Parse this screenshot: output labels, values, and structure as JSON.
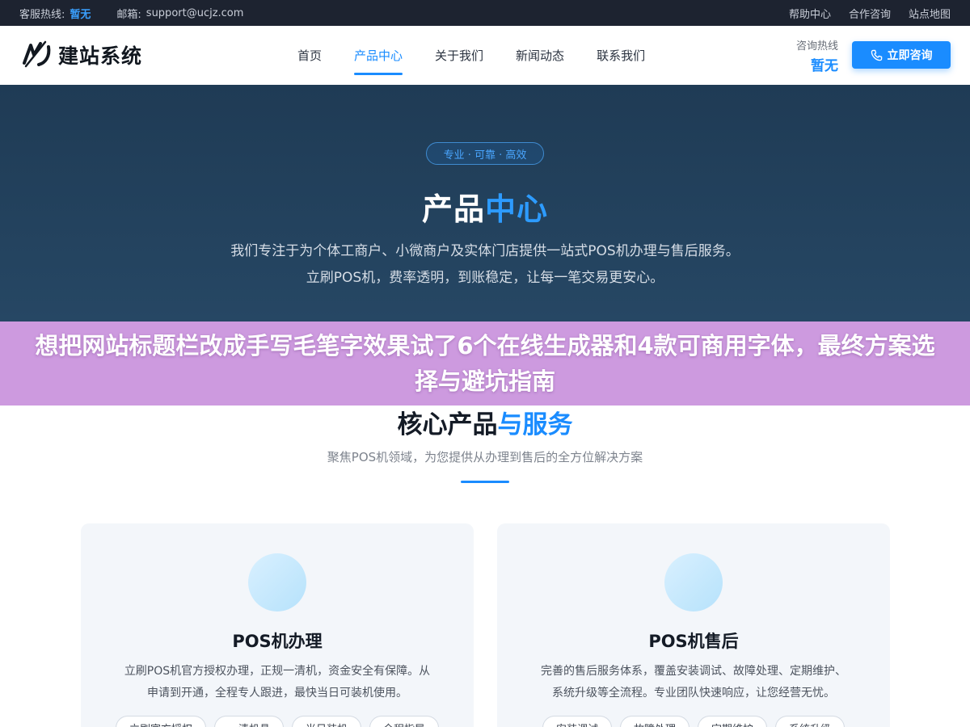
{
  "topbar": {
    "hotline_label": "客服热线:",
    "hotline_value": "暂无",
    "email_label": "邮箱:",
    "email_value": "support@ucjz.com",
    "links": [
      "帮助中心",
      "合作咨询",
      "站点地图"
    ]
  },
  "header": {
    "logo_text": "建站系统",
    "nav": [
      "首页",
      "产品中心",
      "关于我们",
      "新闻动态",
      "联系我们"
    ],
    "active_nav": "产品中心",
    "consult_label": "咨询热线",
    "consult_value": "暂无",
    "cta_label": "立即咨询"
  },
  "hero": {
    "pill": "专业 · 可靠 · 高效",
    "title_main": "产品",
    "title_accent": "中心",
    "desc_line1": "我们专注于为个体工商户、小微商户及实体门店提供一站式POS机办理与售后服务。",
    "desc_line2": "立刷POS机，费率透明，到账稳定，让每一笔交易更安心。"
  },
  "banner": {
    "text": "想把网站标题栏改成手写毛笔字效果试了6个在线生成器和4款可商用字体，最终方案选择与避坑指南"
  },
  "section": {
    "title_main": "核心产品",
    "title_accent": "与服务",
    "subtitle": "聚焦POS机领域，为您提供从办理到售后的全方位解决方案"
  },
  "cards": [
    {
      "title": "POS机办理",
      "desc_line1": "立刷POS机官方授权办理，正规一清机，资金安全有保障。从",
      "desc_line2": "申请到开通，全程专人跟进，最快当日可装机使用。",
      "tags": [
        "立刷官方授权",
        "一清机具",
        "当日装机",
        "全程指导"
      ]
    },
    {
      "title": "POS机售后",
      "desc_line1": "完善的售后服务体系，覆盖安装调试、故障处理、定期维护、",
      "desc_line2": "系统升级等全流程。专业团队快速响应，让您经营无忧。",
      "tags": [
        "安装调试",
        "故障处理",
        "定期维护",
        "系统升级"
      ]
    }
  ],
  "colors": {
    "brand_blue": "#1a8cff",
    "topbar_bg": "#1d2330",
    "hero_bg": "#264764",
    "banner_bg": "#cd9adf"
  }
}
